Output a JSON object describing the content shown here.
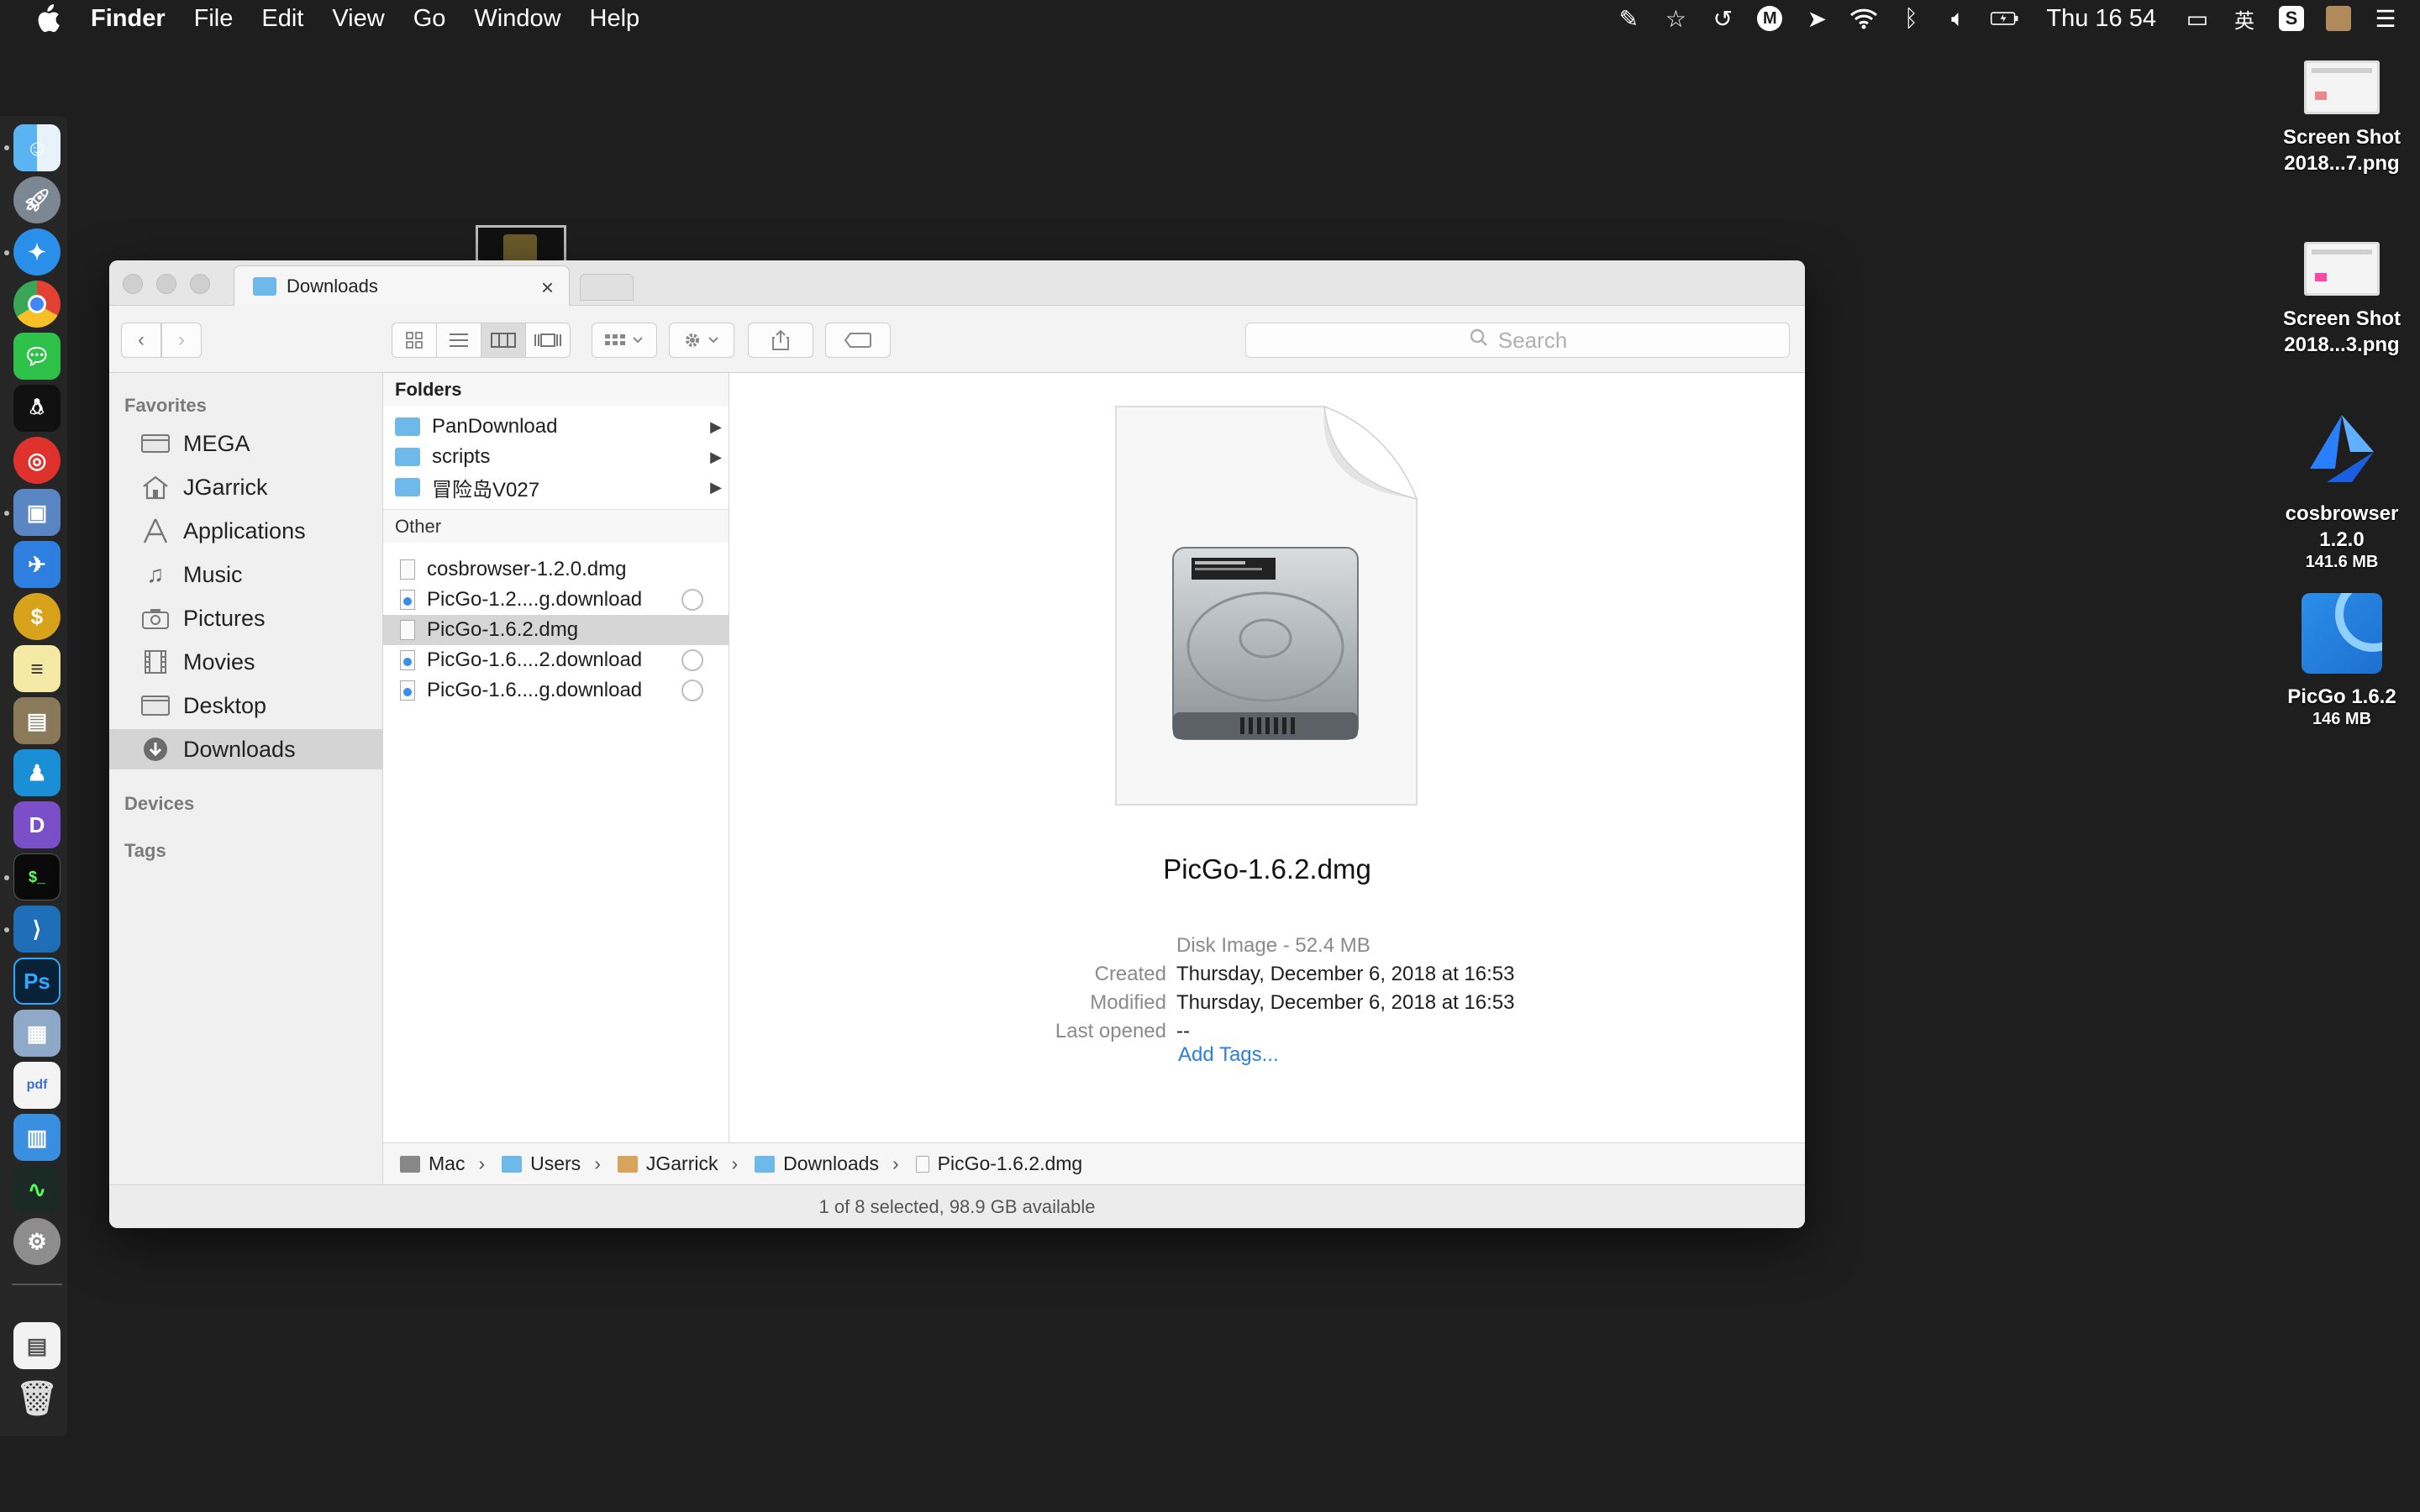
{
  "menubar": {
    "app_name": "Finder",
    "menus": [
      "File",
      "Edit",
      "View",
      "Go",
      "Window",
      "Help"
    ],
    "clock": "Thu 16 54",
    "input_method": "英"
  },
  "desktop": {
    "items": [
      {
        "label_line1": "Screen Shot",
        "label_line2": "2018...7.png",
        "size": ""
      },
      {
        "label_line1": "Screen Shot",
        "label_line2": "2018...3.png",
        "size": ""
      },
      {
        "label_line1": "cosbrowser",
        "label_line2": "1.2.0",
        "size": "141.6 MB"
      },
      {
        "label_line1": "PicGo 1.6.2",
        "label_line2": "",
        "size": "146 MB"
      }
    ]
  },
  "window": {
    "tab_title": "Downloads",
    "search_placeholder": "Search",
    "sidebar": {
      "favorites_header": "Favorites",
      "items": [
        "MEGA",
        "JGarrick",
        "Applications",
        "Music",
        "Pictures",
        "Movies",
        "Desktop",
        "Downloads"
      ],
      "devices_header": "Devices",
      "tags_header": "Tags"
    },
    "column": {
      "folders_header": "Folders",
      "folders": [
        "PanDownload",
        "scripts",
        "冒险岛V027"
      ],
      "other_header": "Other",
      "files": [
        "cosbrowser-1.2.0.dmg",
        "PicGo-1.2....g.download",
        "PicGo-1.6.2.dmg",
        "PicGo-1.6....2.download",
        "PicGo-1.6....g.download"
      ]
    },
    "preview": {
      "name": "PicGo-1.6.2.dmg",
      "kind": "Disk Image - 52.4 MB",
      "created_label": "Created",
      "created": "Thursday, December 6, 2018 at 16:53",
      "modified_label": "Modified",
      "modified": "Thursday, December 6, 2018 at 16:53",
      "last_opened_label": "Last opened",
      "last_opened": "--",
      "add_tags": "Add Tags..."
    },
    "pathbar": [
      "Mac",
      "Users",
      "JGarrick",
      "Downloads",
      "PicGo-1.6.2.dmg"
    ],
    "status": "1 of 8 selected, 98.9 GB available"
  },
  "colors": {
    "desktop_bg": "#1e1e1e",
    "accent_link": "#2a7fe0",
    "folder_blue": "#6fb8ea",
    "selection_gray": "#d6d6d6"
  }
}
